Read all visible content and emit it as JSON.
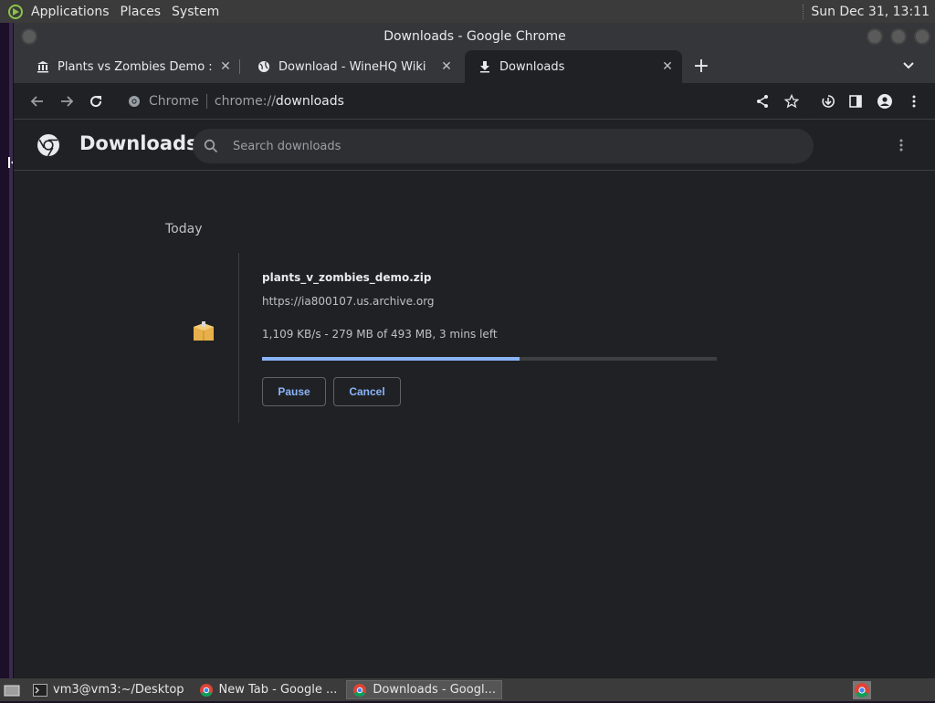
{
  "top_panel": {
    "menus": [
      "Applications",
      "Places",
      "System"
    ],
    "clock": "Sun Dec 31, 13:11"
  },
  "window": {
    "title": "Downloads - Google Chrome"
  },
  "tabs": [
    {
      "title": "Plants vs Zombies Demo : Po",
      "icon": "archive-icon"
    },
    {
      "title": "Download - WineHQ Wiki",
      "icon": "globe-icon"
    },
    {
      "title": "Downloads",
      "icon": "download-icon",
      "active": true
    }
  ],
  "toolbar": {
    "chip": "Chrome",
    "url_scheme": "chrome://",
    "url_host": "downloads"
  },
  "downloads": {
    "title": "Downloads",
    "search_placeholder": "Search downloads",
    "section": "Today",
    "item": {
      "filename": "plants_v_zombies_demo.zip",
      "url": "https://ia800107.us.archive.org",
      "status": "1,109 KB/s - 279 MB of 493 MB, 3 mins left",
      "progress": 0.566,
      "pause_label": "Pause",
      "cancel_label": "Cancel"
    }
  },
  "taskbar": {
    "tasks": [
      {
        "label": "vm3@vm3:~/Desktop",
        "icon": "terminal-icon"
      },
      {
        "label": "New Tab - Google ...",
        "icon": "chrome-icon"
      },
      {
        "label": "Downloads - Googl...",
        "icon": "chrome-icon",
        "active": true
      }
    ]
  },
  "colors": {
    "accent": "#8ab4f8",
    "page_bg": "#202124",
    "frame_bg": "#35363a"
  }
}
